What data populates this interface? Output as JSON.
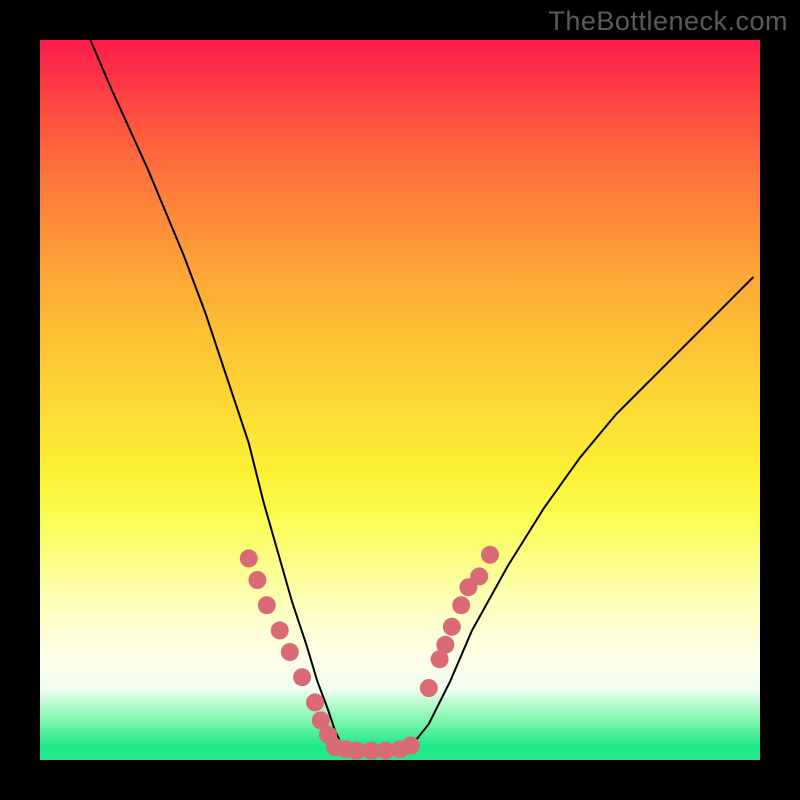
{
  "watermark": "TheBottleneck.com",
  "chart_data": {
    "type": "line",
    "title": "",
    "xlabel": "",
    "ylabel": "",
    "xlim": [
      0,
      100
    ],
    "ylim": [
      0,
      100
    ],
    "grid": false,
    "legend": false,
    "series": [
      {
        "name": "curve",
        "x": [
          7,
          10,
          15,
          20,
          23,
          26,
          29,
          31,
          33,
          35,
          37,
          38.5,
          40,
          41,
          42,
          43,
          44,
          45,
          47,
          50,
          52,
          54,
          57,
          60,
          65,
          70,
          75,
          80,
          85,
          90,
          95,
          99
        ],
        "y": [
          100,
          93,
          82,
          70,
          62,
          53,
          44,
          36,
          29,
          22,
          16,
          11,
          7,
          4,
          2,
          1.5,
          1.3,
          1.3,
          1.3,
          1.4,
          2.5,
          5,
          11,
          18,
          27,
          35,
          42,
          48,
          53,
          58,
          63,
          67
        ]
      }
    ],
    "markers_left": {
      "name": "left-dots",
      "x": [
        29.0,
        30.2,
        31.5,
        33.3,
        34.7,
        36.4,
        38.2,
        39.0,
        40.0
      ],
      "y": [
        28.0,
        25.0,
        21.5,
        18.0,
        15.0,
        11.5,
        8.0,
        5.5,
        3.5
      ]
    },
    "markers_right": {
      "name": "right-dots",
      "x": [
        54.0,
        55.5,
        56.3,
        57.2,
        58.5,
        59.5,
        61.0,
        62.5
      ],
      "y": [
        10.0,
        14.0,
        16.0,
        18.5,
        21.5,
        24.0,
        25.5,
        28.5
      ]
    },
    "markers_bottom": {
      "name": "bottom-dots",
      "x": [
        41.0,
        42.5,
        44.0,
        46.0,
        48.0,
        50.0,
        51.5
      ],
      "y": [
        1.8,
        1.5,
        1.3,
        1.3,
        1.3,
        1.5,
        2.0
      ]
    },
    "marker_color": "#d96a76",
    "marker_radius_px": 9,
    "curve_color": "#000000",
    "curve_stroke_px": 2
  }
}
